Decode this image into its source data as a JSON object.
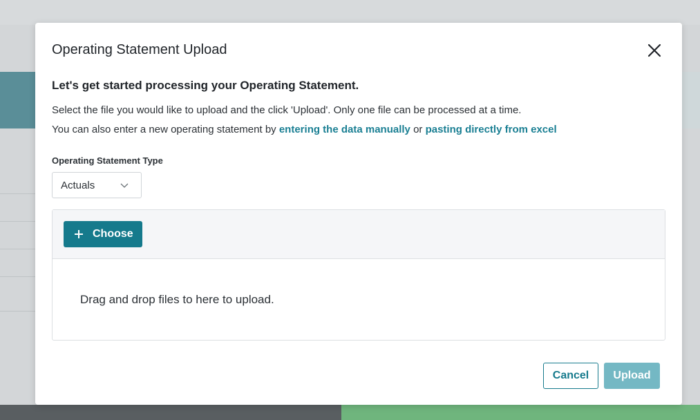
{
  "modal": {
    "title": "Operating Statement Upload",
    "heading": "Let's get started processing your Operating Statement.",
    "description_line1": "Select the file you would like to upload and the click 'Upload'. Only one file can be processed at a time.",
    "description_line2_prefix": "You can also enter a new operating statement by",
    "link_manual": "entering the data manually",
    "description_line2_mid": "or",
    "link_excel": "pasting directly from excel",
    "statement_type_label": "Operating Statement Type",
    "statement_type_value": "Actuals",
    "choose_label": "Choose",
    "drop_text": "Drag and drop files to here to upload.",
    "cancel_label": "Cancel",
    "upload_label": "Upload",
    "upload_disabled": true
  },
  "icons": {
    "close": "close-icon",
    "dropdown": "chevron-down-icon",
    "choose": "plus-icon"
  },
  "colors": {
    "accent": "#157a8c",
    "link": "#1a7f93",
    "upload_disabled": "#74b8c4",
    "background_green": "#6fb57d",
    "background_dark": "#595e61"
  }
}
